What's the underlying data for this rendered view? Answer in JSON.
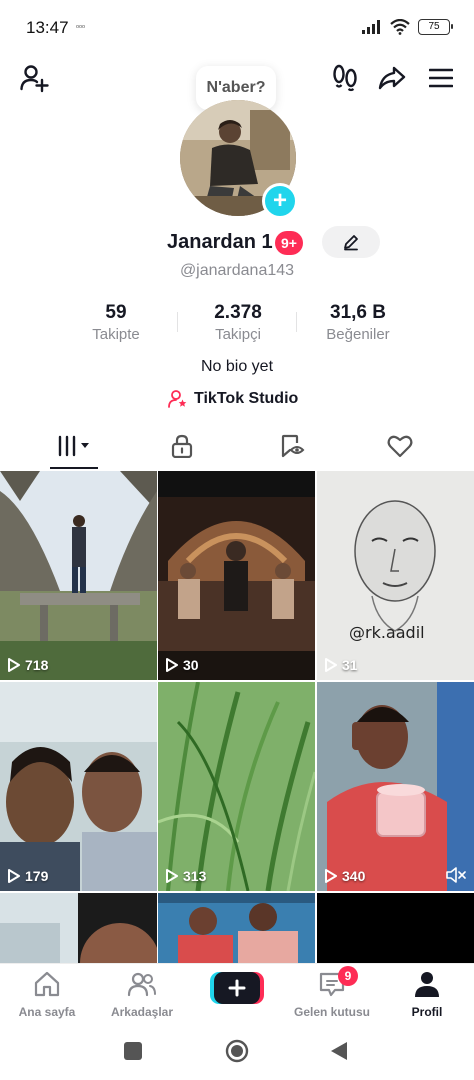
{
  "status_bar": {
    "time": "13:47",
    "extra": "ᵒᵒᵒ",
    "battery": "75"
  },
  "header": {
    "bubble_text": "N'aber?"
  },
  "profile": {
    "display_name": "Janardan 1",
    "badge": "9+",
    "username": "@janardana143",
    "bio": "No bio yet",
    "studio_label": "TikTok Studio"
  },
  "stats": [
    {
      "value": "59",
      "label": "Takipte"
    },
    {
      "value": "2.378",
      "label": "Takipçi"
    },
    {
      "value": "31,6 B",
      "label": "Beğeniler"
    }
  ],
  "grid": {
    "tiles": [
      {
        "views": "718"
      },
      {
        "views": "30"
      },
      {
        "views": "31",
        "tag": "@rk.aadil"
      },
      {
        "views": "179"
      },
      {
        "views": "313"
      },
      {
        "views": "340"
      }
    ]
  },
  "bottom_nav": {
    "home": "Ana sayfa",
    "friends": "Arkadaşlar",
    "inbox": "Gelen kutusu",
    "inbox_badge": "9",
    "profile": "Profil"
  },
  "colors": {
    "accent": "#fe2c55",
    "cyan": "#20d5ec",
    "text": "#161823",
    "muted": "#8a8b91"
  }
}
